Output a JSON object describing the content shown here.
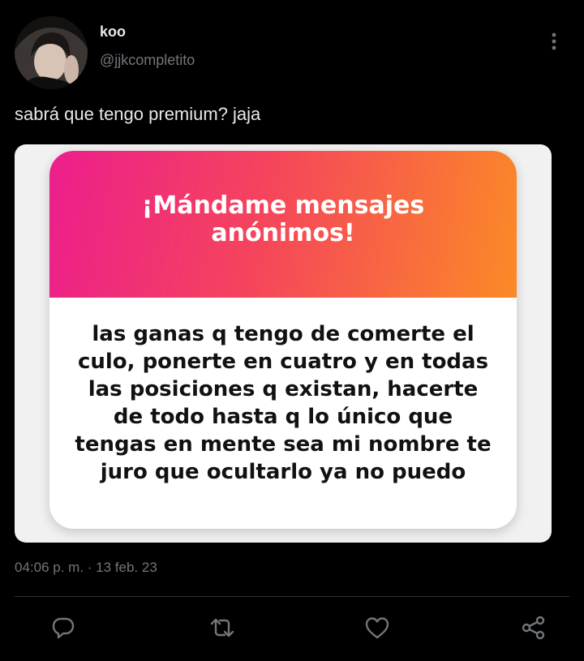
{
  "tweet": {
    "author": {
      "display_name": "koo",
      "handle": "@jjkcompletito",
      "avatar_icon": "profile-photo"
    },
    "text": "sabrá que tengo premium? jaja",
    "media": {
      "card_title": "¡Mándame mensajes anónimos!",
      "card_message": "las ganas q tengo de comerte el culo, ponerte en cuatro y en todas las posiciones q existan, hacerte de todo hasta q lo único que tengas en mente sea mi nombre te juro que ocultarlo ya no puedo",
      "gradient_colors": [
        "#ec1e8c",
        "#f5445c",
        "#fb8a26"
      ]
    },
    "timestamp": "04:06 p. m. · 13 feb. 23",
    "actions": [
      {
        "icon": "reply-icon"
      },
      {
        "icon": "retweet-icon"
      },
      {
        "icon": "like-icon"
      },
      {
        "icon": "share-icon"
      }
    ]
  },
  "colors": {
    "background": "#000000",
    "text_primary": "#e7e9ea",
    "text_secondary": "#71767b",
    "divider": "#2f3336"
  }
}
